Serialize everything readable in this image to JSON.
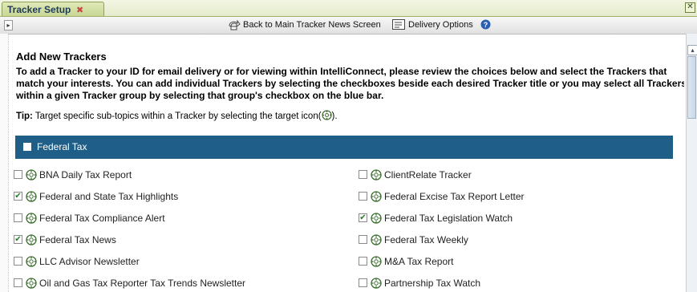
{
  "tab": {
    "title": "Tracker Setup",
    "close_glyph": "✖"
  },
  "window": {
    "close_glyph": "✕"
  },
  "toolbar": {
    "panel_toggle_glyph": "▸",
    "back_label": "Back to Main Tracker News Screen",
    "delivery_label": "Delivery Options",
    "help_icon": "help-icon"
  },
  "content": {
    "heading": "Add New Trackers",
    "intro": "To add a Tracker to your ID for email delivery or for viewing within IntelliConnect, please review the choices below and select the Trackers that match your interests. You can add individual Trackers by selecting the checkboxes beside each desired Tracker title or you may select all Trackers within a given Tracker group by selecting that group's checkbox on the blue bar.",
    "tip_label": "Tip:",
    "tip_text": "Target specific sub-topics within a Tracker by selecting the target icon(",
    "tip_close": ")."
  },
  "group": {
    "name": "Federal Tax",
    "color": "#1f5f87",
    "checked": false
  },
  "trackers_left": [
    {
      "label": "BNA Daily Tax Report",
      "checked": false
    },
    {
      "label": "Federal and State Tax Highlights",
      "checked": true
    },
    {
      "label": "Federal Tax Compliance Alert",
      "checked": false
    },
    {
      "label": "Federal Tax News",
      "checked": true
    },
    {
      "label": "LLC Advisor Newsletter",
      "checked": false
    },
    {
      "label": "Oil and Gas Tax Reporter Tax Trends Newsletter",
      "checked": false
    }
  ],
  "trackers_right": [
    {
      "label": "ClientRelate Tracker",
      "checked": false
    },
    {
      "label": "Federal Excise Tax Report Letter",
      "checked": false
    },
    {
      "label": "Federal Tax Legislation Watch",
      "checked": true
    },
    {
      "label": "Federal Tax Weekly",
      "checked": false
    },
    {
      "label": "M&A Tax Report",
      "checked": false
    },
    {
      "label": "Partnership Tax Watch",
      "checked": false
    }
  ]
}
